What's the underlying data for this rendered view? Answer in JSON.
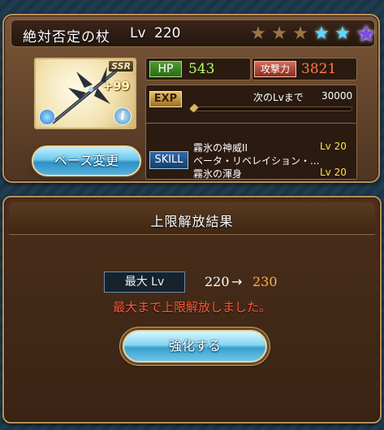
{
  "weapon": {
    "name": "絶対否定の杖",
    "level_label": "Lv",
    "level": "220",
    "stars": [
      {
        "type": "bronze",
        "icon": "star-bronze-icon"
      },
      {
        "type": "bronze",
        "icon": "star-bronze-icon"
      },
      {
        "type": "bronze",
        "icon": "star-bronze-icon"
      },
      {
        "type": "blue",
        "icon": "star-blue-icon"
      },
      {
        "type": "blue",
        "icon": "star-blue-icon"
      },
      {
        "type": "purple",
        "icon": "star-purple-icon"
      }
    ],
    "rarity": "SSR",
    "plus": "+99",
    "element_icon": "water-element-icon",
    "info_icon": "info-icon",
    "base_change_label": "ベース変更"
  },
  "stats": {
    "hp_label": "HP",
    "hp": "543",
    "atk_label": "攻撃力",
    "atk": "3821",
    "exp_label": "EXP",
    "exp_next_label": "次のLvまで",
    "exp_next": "30000",
    "exp_progress": 0.0
  },
  "skills": {
    "label": "SKILL",
    "items": [
      {
        "name": "霧氷の神威II",
        "lv": "Lv  20"
      },
      {
        "name": "ベータ・リベレイション・...",
        "lv": ""
      },
      {
        "name": "霧氷の渾身",
        "lv": "Lv  20"
      }
    ]
  },
  "result": {
    "title": "上限解放結果",
    "max_lv_label": "最大 Lv",
    "old_lv": "220",
    "arrow": "→",
    "new_lv": "230",
    "message": "最大まで上限解放しました。",
    "enhance_label": "強化する"
  },
  "colors": {
    "hp_value": "#b6ff6a",
    "atk_value": "#ff7a4a",
    "new_lv": "#ffb24a",
    "message": "#ff5a3a",
    "skill_lv": "#ffe14a"
  }
}
